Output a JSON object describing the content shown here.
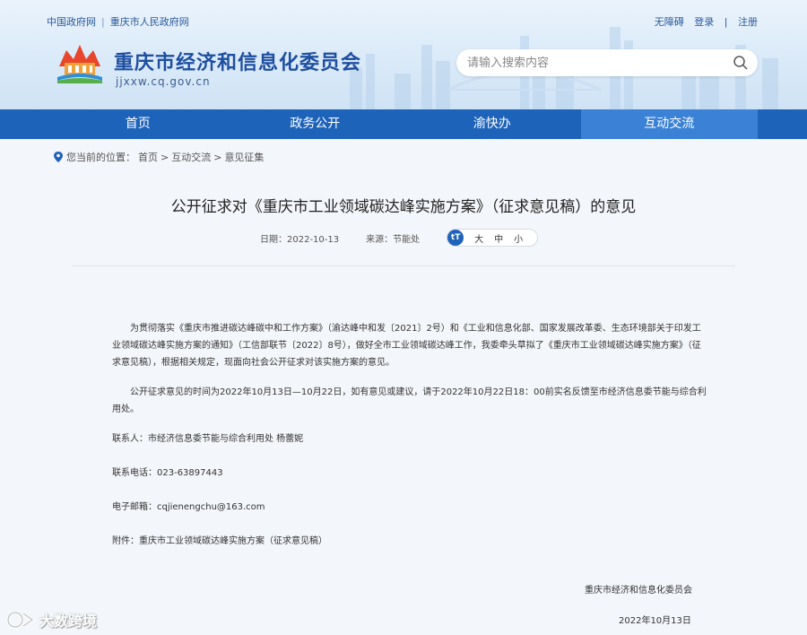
{
  "header": {
    "top_links_left": [
      "中国政府网",
      "重庆市人民政府网"
    ],
    "top_links_right": [
      "无障碍",
      "登录",
      "注册"
    ],
    "site_title": "重庆市经济和信息化委员会",
    "site_url": "jjxxw.cq.gov.cn",
    "search_placeholder": "请输入搜索内容"
  },
  "nav": {
    "items": [
      "首页",
      "政务公开",
      "渝快办",
      "互动交流"
    ],
    "active_index": 3
  },
  "breadcrumb": {
    "prefix": "您当前的位置：",
    "items": [
      "首页",
      "互动交流",
      "意见征集"
    ],
    "separator": ">"
  },
  "article": {
    "title": "公开征求对《重庆市工业领域碳达峰实施方案》（征求意见稿）的意见",
    "date_label": "日期：2022-10-13",
    "source_label": "来源：节能处",
    "font_size_icon": "tT",
    "font_sizes": [
      "大",
      "中",
      "小"
    ],
    "paragraphs": [
      "为贯彻落实《重庆市推进碳达峰碳中和工作方案》（渝达峰中和发〔2021〕2号）和《工业和信息化部、国家发展改革委、生态环境部关于印发工业领域碳达峰实施方案的通知》（工信部联节〔2022〕8号），做好全市工业领域碳达峰工作，我委牵头草拟了《重庆市工业领域碳达峰实施方案》（征求意见稿），根据相关规定，现面向社会公开征求对该实施方案的意见。",
      "公开征求意见的时间为2022年10月13日—10月22日，如有意见或建议，请于2022年10月22日18：00前实名反馈至市经济信息委节能与综合利用处。"
    ],
    "contact_person": "联系人：市经济信息委节能与综合利用处 杨蕾妮",
    "contact_phone": "联系电话：023-63897443",
    "email": "电子邮箱：cqjienengchu@163.com",
    "attachment_prefix": "附件：",
    "attachment_link": "重庆市工业领域碳达峰实施方案（征求意见稿）",
    "signature": "重庆市经济和信息化委员会",
    "signature_date": "2022年10月13日"
  },
  "watermark": {
    "text": "大数跨境"
  },
  "colors": {
    "nav_bg": "#1e63ba",
    "nav_active": "#3b82d6",
    "title_blue": "#1e4fa0"
  }
}
